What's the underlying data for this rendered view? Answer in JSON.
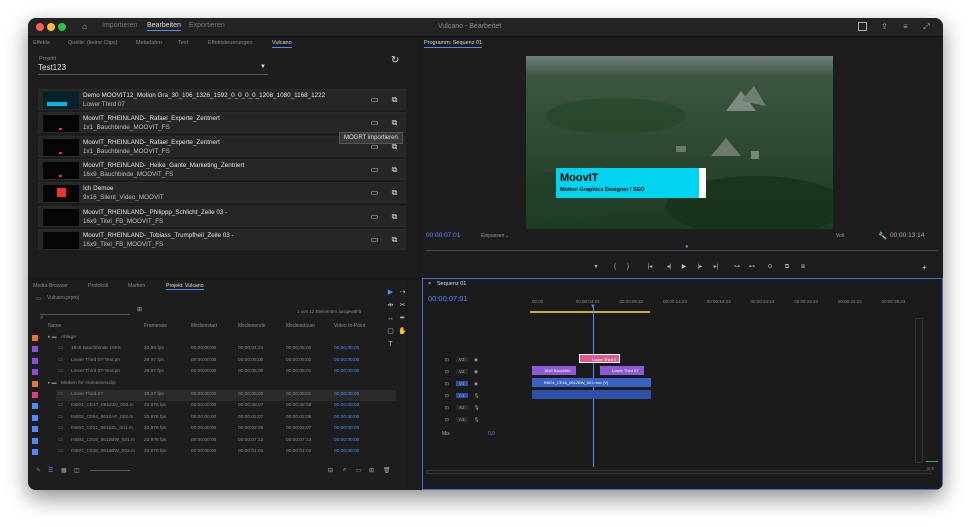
{
  "titlebar": {
    "tabs": [
      "Importieren",
      "Bearbeiten",
      "Exportieren"
    ],
    "active_tab": "Bearbeiten",
    "title": "Vulcano - Bearbeitet"
  },
  "source_panel": {
    "tabs": [
      "Effekte",
      "Quelle: (keine Clips)",
      "Metadaten",
      "Text",
      "Effektsteuerungen",
      "Vulcano"
    ],
    "active_tab": "Vulcano",
    "project_label": "Projekt",
    "project_value": "Test123",
    "tooltip": "MOGRT importieren",
    "items": [
      {
        "name": "Demo MOOVIT12_Motion Gra_30_106_1326_1592_0_0_0_0_1208_1080_1168_1222",
        "sub": "Lower Third 07",
        "thumb": "#06202c"
      },
      {
        "name": "MoovIT_RHEINLAND-_Rafael_Experte_Zentriert",
        "sub": "1x1_Bauchbinde_MOOVIT_FS",
        "thumb": "#050505"
      },
      {
        "name": "MoovIT_RHEINLAND-_Rafael_Experte_Zentriert",
        "sub": "1x1_Bauchbinde_MOOVIT_FS",
        "thumb": "#050505"
      },
      {
        "name": "MoovIT_RHEINLAND-_Heike_Gante_Marketing_Zentriert",
        "sub": "16x9_Bauchbinde_MOOVIT_FS",
        "thumb": "#050505"
      },
      {
        "name": "Ich Demoe",
        "sub": "9x16_Silent_Video_MOOVIT",
        "thumb": "#050505"
      },
      {
        "name": "MoovIT_RHEINLAND-_Philippp_Schlicht_Zeile 03 -",
        "sub": "16x9_Titel_FB_MOOVIT_FS",
        "thumb": "#050505"
      },
      {
        "name": "MoovIT_RHEINLAND-_Tobiass_Trumpfheil_Zeile 03 -",
        "sub": "16x9_Titel_FB_MOOVIT_FS",
        "thumb": "#050505"
      }
    ]
  },
  "program": {
    "tab": "Programm: Sequenz 01",
    "lower_third_title": "MoovIT",
    "lower_third_sub": "Motion Graphics Designer / SEO",
    "timecode": "00:00:07:01",
    "fit": "Einpassen",
    "quality": "Voll",
    "duration": "00:00:13:14"
  },
  "project_panel": {
    "tabs": [
      "Media-Browser",
      "Protokoll",
      "Marken",
      "Projekt: Vulcano"
    ],
    "active_tab": "Projekt: Vulcano",
    "file": "Vulcano.prproj",
    "count": "1 von 12 Elementen ausgewählt",
    "columns": [
      "Name",
      "Framerate",
      "Medienstart",
      "Medienende",
      "Mediendauer",
      "Video In-Point"
    ],
    "rows": [
      {
        "name": "Ablage",
        "rate": "",
        "start": "",
        "end": "",
        "dur": "",
        "in": "",
        "color": "#e07a2a",
        "folder": true
      },
      {
        "name": "16x9 Bauchbinde 16K6",
        "rate": "23,98 fps",
        "start": "00;00;00;00",
        "end": "00;00;04;24",
        "dur": "00;00;05;00",
        "in": "00;00;00;00",
        "color": "#8a4fd6"
      },
      {
        "name": "Lower Third 07-Text.pn",
        "rate": "29,97 fps",
        "start": "00;00;00;00",
        "end": "00;00;05;00",
        "dur": "00;00;05;01",
        "in": "00;00;00;00",
        "color": "#8a4fd6"
      },
      {
        "name": "Lower Third 07-Text.pn",
        "rate": "29,97 fps",
        "start": "00;00;00;00",
        "end": "00;00;05;00",
        "dur": "00;00;05;01",
        "in": "00;00;00;00",
        "color": "#8a4fd6"
      },
      {
        "name": "Medien für Animationsclip",
        "rate": "",
        "start": "",
        "end": "",
        "dur": "",
        "in": "",
        "color": "#e07a2a",
        "folder": true
      },
      {
        "name": "Lower Third 07",
        "rate": "29,97 fps",
        "start": "00;00;00;00",
        "end": "00;00;05;00",
        "dur": "00;00;05;01",
        "in": "00;00;00;00",
        "color": "#e0407a"
      },
      {
        "name": "IN001_CE47_0612JN_003.m",
        "rate": "23,976 fps",
        "start": "00:00:00:00",
        "end": "00:00:08:07",
        "dur": "00:00:08:08",
        "in": "00:00:00:00",
        "color": "#4a8cff"
      },
      {
        "name": "IN002_C064_0612AF_002.m",
        "rate": "23,976 fps",
        "start": "00:00:00:00",
        "end": "00:00:02:07",
        "dur": "00:00:02:08",
        "in": "00:00:00:00",
        "color": "#4a8cff"
      },
      {
        "name": "IN003_C021_0612ZL_001.m",
        "rate": "23,976 fps",
        "start": "00:00:00:00",
        "end": "00:00:02:06",
        "dur": "00:00:02:07",
        "in": "00:00:00:00",
        "color": "#4a8cff"
      },
      {
        "name": "IN004_C018_0612BW_001.m",
        "rate": "23,976 fps",
        "start": "00:00:00:00",
        "end": "00:00:07:12",
        "dur": "00:00:07:13",
        "in": "00:00:00:00",
        "color": "#4a8cff"
      },
      {
        "name": "IN007_C018_0613BW_003.m",
        "rate": "23,976 fps",
        "start": "00:00:00:00",
        "end": "00:00:01:01",
        "dur": "00:00:01:02",
        "in": "00:00:00:00",
        "color": "#4a8cff"
      }
    ]
  },
  "timeline": {
    "tab": "Sequenz 01",
    "timecode": "00:00:07:01",
    "ruler": [
      "00:00",
      "00:00:04:23",
      "00:00:09:23",
      "00:00:14:23",
      "00:00:19:23",
      "00:00:24:23",
      "00:00:29:23",
      "00:00:34:23",
      "00:00:39:23"
    ],
    "tracks": [
      "V3",
      "V2",
      "V1",
      "A1",
      "A2",
      "A3"
    ],
    "mix_label": "Mix",
    "mix_value": "0,0",
    "clips": {
      "v3": "Lower Third 0",
      "v2a": "16x9 Bauchbin",
      "v2b": "Lower Third 07",
      "v1": "IN001_CE16_0612BW_001.mov [V]"
    },
    "meter_label": "S S"
  },
  "colors": {
    "accent": "#4a8cff",
    "lowerthird": "#00d4f0",
    "clip_purple": "#8f5ad8",
    "clip_blue": "#3a62c4",
    "clip_pink": "#e05a8c"
  }
}
